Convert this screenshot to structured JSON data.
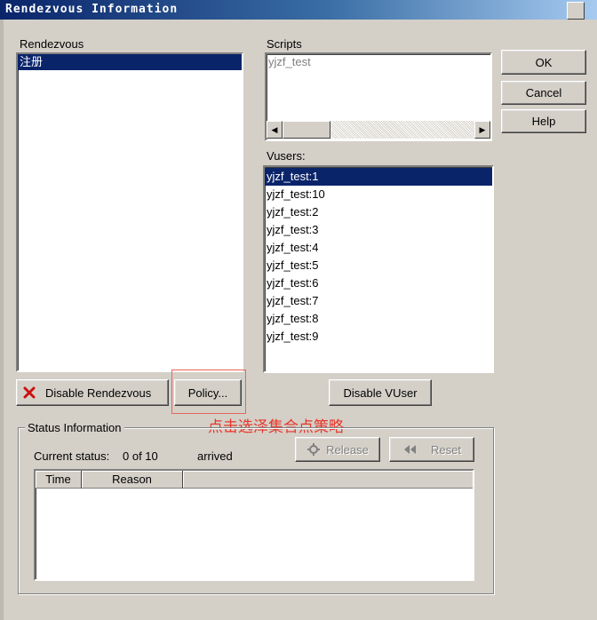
{
  "window": {
    "title": "Rendezvous Information"
  },
  "rendezvous": {
    "label": "Rendezvous",
    "items": [
      "注册"
    ]
  },
  "scripts": {
    "label": "Scripts",
    "items": [
      "yjzf_test"
    ]
  },
  "vusers": {
    "label": "Vusers:",
    "items": [
      "yjzf_test:1",
      "yjzf_test:10",
      "yjzf_test:2",
      "yjzf_test:3",
      "yjzf_test:4",
      "yjzf_test:5",
      "yjzf_test:6",
      "yjzf_test:7",
      "yjzf_test:8",
      "yjzf_test:9"
    ]
  },
  "buttons": {
    "ok": "OK",
    "cancel": "Cancel",
    "help": "Help",
    "disable_rendezvous": "Disable Rendezvous",
    "policy": "Policy...",
    "disable_vuser": "Disable VUser",
    "release": "Release",
    "reset": "Reset"
  },
  "status": {
    "group_label": "Status Information",
    "current_status_label": "Current status:",
    "count": "0 of 10",
    "arrived": "arrived",
    "columns": [
      "Time",
      "Reason"
    ]
  },
  "annotation": {
    "text": "点击选泽集合点策略",
    "color": "#e8362a"
  },
  "colors": {
    "selection": "#0a246a",
    "face": "#d4d0c8",
    "title_start": "#0a246a"
  }
}
